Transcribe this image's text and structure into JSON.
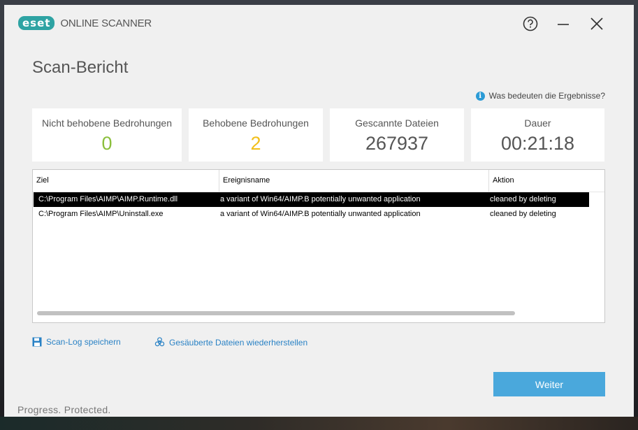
{
  "header": {
    "brand": "eset",
    "product": "ONLINE SCANNER"
  },
  "page_title": "Scan-Bericht",
  "help_link": "Was bedeuten die Ergebnisse?",
  "stats": [
    {
      "label": "Nicht behobene Bedrohungen",
      "value": "0",
      "color": "#8bbf3c"
    },
    {
      "label": "Behobene Bedrohungen",
      "value": "2",
      "color": "#f2bf1a"
    },
    {
      "label": "Gescannte Dateien",
      "value": "267937",
      "color": "#555555"
    },
    {
      "label": "Dauer",
      "value": "00:21:18",
      "color": "#555555"
    }
  ],
  "table": {
    "columns": [
      "Ziel",
      "Ereignisname",
      "Aktion"
    ],
    "rows": [
      {
        "ziel": "C:\\Program Files\\AIMP\\AIMP.Runtime.dll",
        "ereignis": "a variant of Win64/AIMP.B potentially unwanted application",
        "aktion": "cleaned by deleting",
        "selected": true
      },
      {
        "ziel": "C:\\Program Files\\AIMP\\Uninstall.exe",
        "ereignis": "a variant of Win64/AIMP.B potentially unwanted application",
        "aktion": "cleaned by deleting",
        "selected": false
      }
    ]
  },
  "links": {
    "save_log": "Scan-Log speichern",
    "restore": "Gesäuberte Dateien wiederherstellen"
  },
  "next_button": "Weiter",
  "slogan": "Progress. Protected.",
  "colors": {
    "accent": "#4aa8dc",
    "brand": "#2ea3a3"
  }
}
